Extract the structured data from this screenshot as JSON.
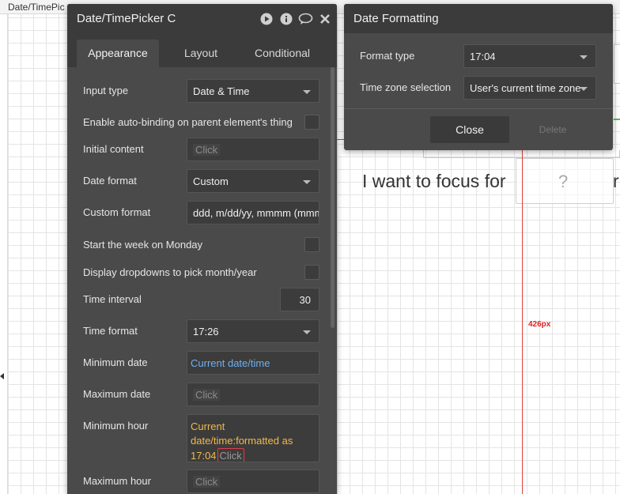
{
  "editor": {
    "breadcrumb": "Date/TimePic",
    "canvas_heading": "I want to focus for",
    "canvas_heading_tail": "r",
    "placeholder_symbol": "?",
    "dimension_label": "426px",
    "guide_color": "#e23b3b"
  },
  "property_panel": {
    "title": "Date/TimePicker C",
    "header_icons": [
      "play-icon",
      "info-icon",
      "comment-icon",
      "close-icon"
    ],
    "tabs": [
      {
        "label": "Appearance",
        "active": true
      },
      {
        "label": "Layout",
        "active": false
      },
      {
        "label": "Conditional",
        "active": false
      }
    ],
    "fields": {
      "input_type": {
        "label": "Input type",
        "value": "Date & Time"
      },
      "auto_binding": {
        "label": "Enable auto-binding on parent element's thing",
        "checked": false
      },
      "initial_content": {
        "label": "Initial content",
        "placeholder": "Click"
      },
      "date_format": {
        "label": "Date format",
        "value": "Custom"
      },
      "custom_format": {
        "label": "Custom format",
        "value": "ddd, m/dd/yy, mmmm (mmm"
      },
      "week_monday": {
        "label": "Start the week on Monday",
        "checked": false
      },
      "dropdowns": {
        "label": "Display dropdowns to pick month/year",
        "checked": false
      },
      "time_interval": {
        "label": "Time interval",
        "value": "30"
      },
      "time_format": {
        "label": "Time format",
        "value": "17:26"
      },
      "minimum_date": {
        "label": "Minimum date",
        "value": "Current date/time"
      },
      "maximum_date": {
        "label": "Maximum date",
        "placeholder": "Click"
      },
      "minimum_hour": {
        "label": "Minimum hour",
        "line1": "Current",
        "line2": "date/time:formatted as",
        "line3": "17:04",
        "placeholder": "Click"
      },
      "maximum_hour": {
        "label": "Maximum hour",
        "placeholder": "Click"
      }
    },
    "colors": {
      "dynamic_blue": "#6db0f2",
      "dynamic_orange": "#f2b84b",
      "panel_bg": "#4a4a4a",
      "header_bg": "#3b3b3b"
    }
  },
  "format_popup": {
    "title": "Date Formatting",
    "format_type": {
      "label": "Format type",
      "value": "17:04"
    },
    "timezone": {
      "label": "Time zone selection",
      "value": "User's current time zone"
    },
    "close_label": "Close",
    "delete_label": "Delete"
  }
}
